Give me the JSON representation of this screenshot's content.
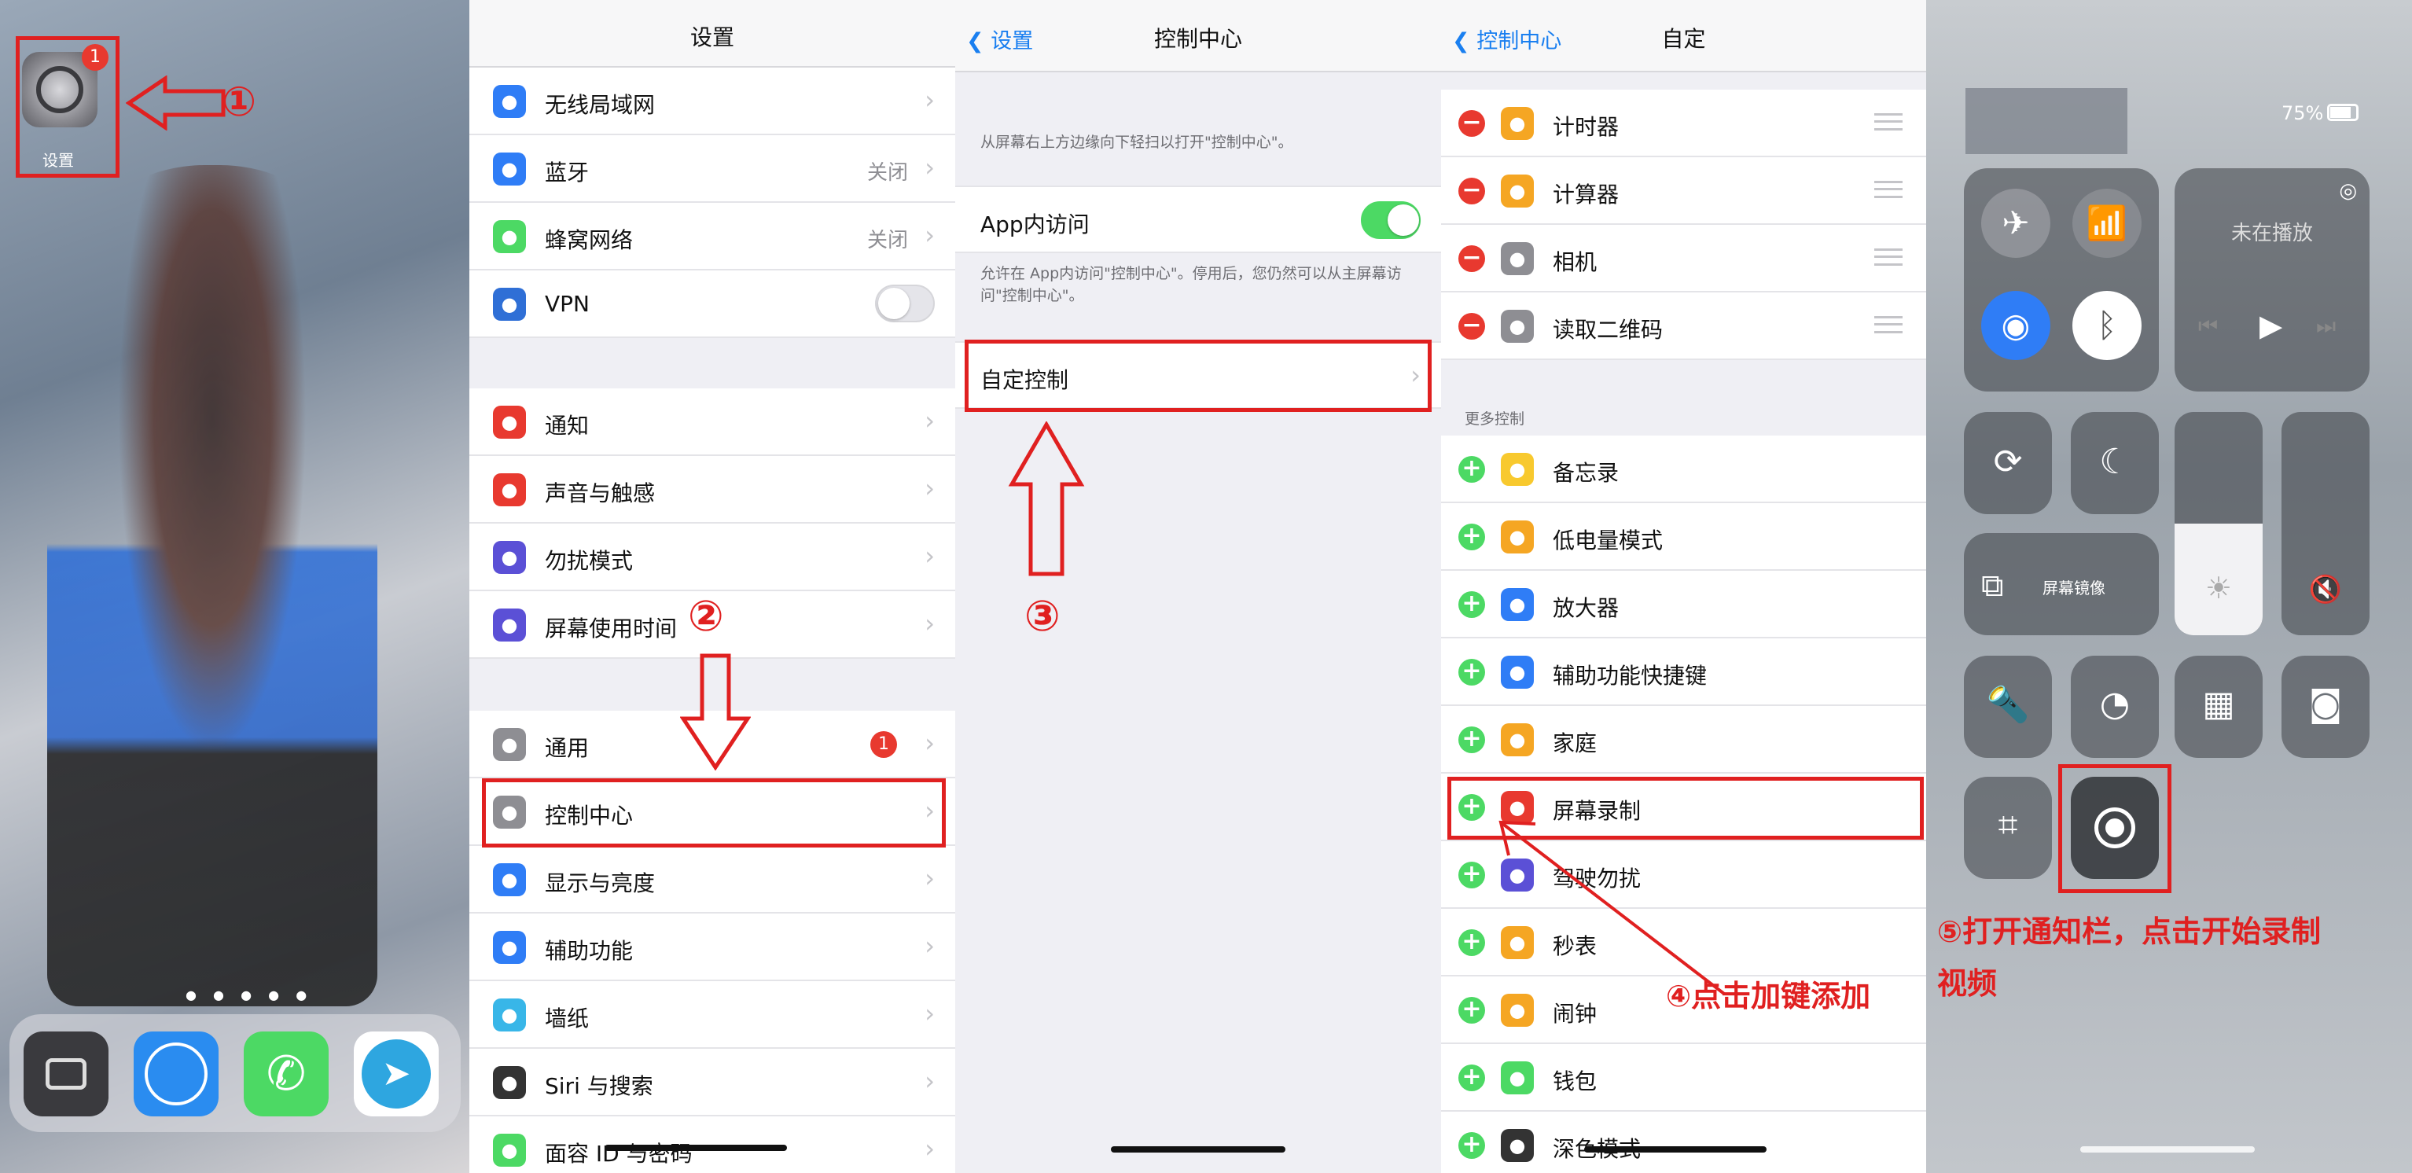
{
  "colors": {
    "ios_blue": "#1a7ff0",
    "annotation_red": "#e02020",
    "switch_green": "#4cd964",
    "delete_red": "#e8392f"
  },
  "home": {
    "settings_icon_label": "设置",
    "settings_badge": "1",
    "step1": "①",
    "dock_icons": [
      "camera-icon",
      "safari-icon",
      "phone-icon",
      "telegram-icon"
    ]
  },
  "settings": {
    "title": "设置",
    "rows": [
      {
        "label": "无线局域网",
        "icon": "wifi-icon",
        "color": "#2f7df6",
        "value": ""
      },
      {
        "label": "蓝牙",
        "icon": "bluetooth-icon",
        "color": "#2f7df6",
        "value": "关闭"
      },
      {
        "label": "蜂窝网络",
        "icon": "antenna-icon",
        "color": "#4cd964",
        "value": "关闭"
      },
      {
        "label": "VPN",
        "icon": "vpn-icon",
        "color": "#2f6fd6",
        "value": ""
      },
      {
        "label": "通知",
        "icon": "notification-icon",
        "color": "#e8392f"
      },
      {
        "label": "声音与触感",
        "icon": "speaker-icon",
        "color": "#e8392f"
      },
      {
        "label": "勿扰模式",
        "icon": "moon-icon",
        "color": "#5b50d6"
      },
      {
        "label": "屏幕使用时间",
        "icon": "hourglass-icon",
        "color": "#5b50d6"
      },
      {
        "label": "通用",
        "icon": "gear-icon",
        "color": "#8e8e93",
        "badge": "1"
      },
      {
        "label": "控制中心",
        "icon": "switches-icon",
        "color": "#8e8e93"
      },
      {
        "label": "显示与亮度",
        "icon": "display-icon",
        "color": "#2f7df6"
      },
      {
        "label": "辅助功能",
        "icon": "accessibility-icon",
        "color": "#2f7df6"
      },
      {
        "label": "墙纸",
        "icon": "flower-icon",
        "color": "#38b6e8"
      },
      {
        "label": "Siri 与搜索",
        "icon": "siri-icon",
        "color": "#333"
      },
      {
        "label": "面容 ID 与密码",
        "icon": "faceid-icon",
        "color": "#4cd964"
      }
    ],
    "step2": "②"
  },
  "control_center": {
    "back": "设置",
    "title": "控制中心",
    "hint": "从屏幕右上方边缘向下轻扫以打开\"控制中心\"。",
    "app_access_label": "App内访问",
    "app_access_desc": "允许在 App内访问\"控制中心\"。停用后，您仍然可以从主屏幕访问\"控制中心\"。",
    "customize_label": "自定控制",
    "step3": "③"
  },
  "customize": {
    "back": "控制中心",
    "title": "自定",
    "included": [
      {
        "label": "计时器",
        "icon": "timer-icon",
        "color": "#f5a623"
      },
      {
        "label": "计算器",
        "icon": "calculator-icon",
        "color": "#f5a623"
      },
      {
        "label": "相机",
        "icon": "camera-icon",
        "color": "#8e8e93"
      },
      {
        "label": "读取二维码",
        "icon": "qr-icon",
        "color": "#8e8e93"
      }
    ],
    "more_header": "更多控制",
    "more": [
      {
        "label": "备忘录",
        "icon": "notes-icon",
        "color": "#f8c92e"
      },
      {
        "label": "低电量模式",
        "icon": "battery-icon",
        "color": "#f5a623"
      },
      {
        "label": "放大器",
        "icon": "magnifier-icon",
        "color": "#2f7df6"
      },
      {
        "label": "辅助功能快捷键",
        "icon": "accessibility-icon",
        "color": "#2f7df6"
      },
      {
        "label": "家庭",
        "icon": "home-icon",
        "color": "#f5a623"
      },
      {
        "label": "屏幕录制",
        "icon": "record-icon",
        "color": "#e8392f"
      },
      {
        "label": "驾驶勿扰",
        "icon": "car-icon",
        "color": "#5b50d6"
      },
      {
        "label": "秒表",
        "icon": "stopwatch-icon",
        "color": "#f5a623"
      },
      {
        "label": "闹钟",
        "icon": "alarm-icon",
        "color": "#f5a623"
      },
      {
        "label": "钱包",
        "icon": "wallet-icon",
        "color": "#4cd964"
      },
      {
        "label": "深色模式",
        "icon": "darkmode-icon",
        "color": "#333"
      }
    ],
    "step4": "④点击加键添加"
  },
  "cc_panel": {
    "battery": "75%",
    "now_playing": "未在播放",
    "screen_mirroring": "屏幕镜像",
    "step5_line1": "⑤打开通知栏，点击开始录制",
    "step5_line2": "视频"
  }
}
